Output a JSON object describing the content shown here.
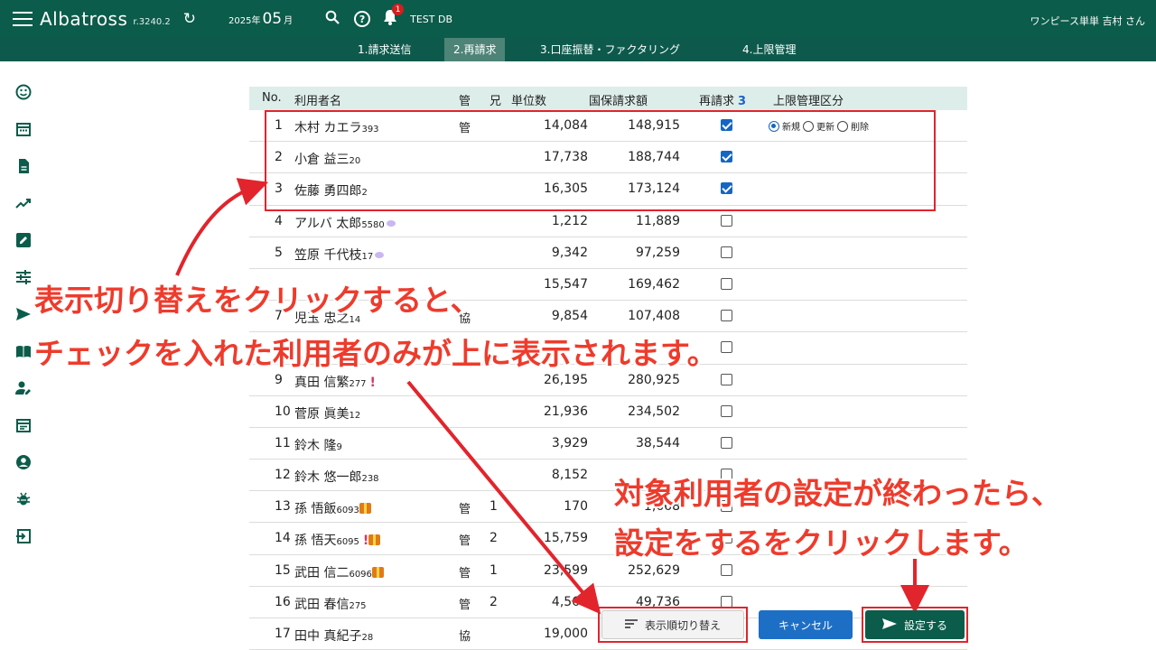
{
  "header": {
    "app_name": "Albatross",
    "version": "r.3240.2",
    "date_year": "2025年",
    "date_month": "05",
    "date_suffix": "月",
    "notification_count": "1",
    "db_name": "TEST DB",
    "user": "ワンピース単単 吉村 さん",
    "bg_color": "#0b5c4a"
  },
  "tabs": [
    {
      "label": "1.請求送信",
      "active": false
    },
    {
      "label": "2.再請求",
      "active": true
    },
    {
      "label": "3.口座振替・ファクタリング",
      "active": false
    },
    {
      "label": "4.上限管理",
      "active": false
    }
  ],
  "sidebar_icons": [
    "smiley-icon",
    "calendar-icon",
    "document-icon",
    "trend-icon",
    "edit-icon",
    "tune-icon",
    "send-icon",
    "book-icon",
    "user-edit-icon",
    "event-icon",
    "account-icon",
    "bug-icon",
    "login-icon"
  ],
  "table": {
    "headers": {
      "no": "No.",
      "name": "利用者名",
      "kan": "管",
      "ani": "兄",
      "unit": "単位数",
      "amount": "国保請求額",
      "resubmit": "再請求",
      "resubmit_count": "3",
      "limit": "上限管理区分"
    },
    "radio_labels": [
      "新規",
      "更新",
      "削除"
    ],
    "rows": [
      {
        "no": "1",
        "name": "木村 カエラ",
        "id": "393",
        "kan": "管",
        "ani": "",
        "unit": "14,084",
        "amount": "148,915",
        "checked": true
      },
      {
        "no": "2",
        "name": "小倉 益三",
        "id": "20",
        "kan": "",
        "ani": "",
        "unit": "17,738",
        "amount": "188,744",
        "checked": true
      },
      {
        "no": "3",
        "name": "佐藤 勇四郎",
        "id": "2",
        "kan": "",
        "ani": "",
        "unit": "16,305",
        "amount": "173,124",
        "checked": true
      },
      {
        "no": "4",
        "name": "アルバ 太郎",
        "id": "5580",
        "kan": "",
        "ani": "",
        "unit": "1,212",
        "amount": "11,889",
        "checked": false
      },
      {
        "no": "5",
        "name": "笠原 千代枝",
        "id": "17",
        "kan": "",
        "ani": "",
        "unit": "9,342",
        "amount": "97,259",
        "checked": false
      },
      {
        "no": "",
        "name": "",
        "id": "",
        "kan": "",
        "ani": "",
        "unit": "15,547",
        "amount": "169,462",
        "checked": false
      },
      {
        "no": "7",
        "name": "児玉 忠之",
        "id": "14",
        "kan": "協",
        "ani": "",
        "unit": "9,854",
        "amount": "107,408",
        "checked": false
      },
      {
        "no": "",
        "name": "",
        "id": "",
        "kan": "",
        "ani": "",
        "unit": "",
        "amount": "",
        "checked": false
      },
      {
        "no": "9",
        "name": "真田 信繁",
        "id": "277",
        "kan": "",
        "ani": "",
        "unit": "26,195",
        "amount": "280,925",
        "checked": false
      },
      {
        "no": "10",
        "name": "菅原 眞美",
        "id": "12",
        "kan": "",
        "ani": "",
        "unit": "21,936",
        "amount": "234,502",
        "checked": false
      },
      {
        "no": "11",
        "name": "鈴木 隆",
        "id": "9",
        "kan": "",
        "ani": "",
        "unit": "3,929",
        "amount": "38,544",
        "checked": false
      },
      {
        "no": "12",
        "name": "鈴木 悠一郎",
        "id": "238",
        "kan": "",
        "ani": "",
        "unit": "8,152",
        "amount": "",
        "checked": false
      },
      {
        "no": "13",
        "name": "孫 悟飯",
        "id": "6093",
        "kan": "管",
        "ani": "1",
        "unit": "170",
        "amount": "1,668",
        "checked": false
      },
      {
        "no": "14",
        "name": "孫 悟天",
        "id": "6095",
        "kan": "管",
        "ani": "2",
        "unit": "15,759",
        "amount": "",
        "checked": false
      },
      {
        "no": "15",
        "name": "武田 信二",
        "id": "6096",
        "kan": "管",
        "ani": "1",
        "unit": "23,599",
        "amount": "252,629",
        "checked": false
      },
      {
        "no": "16",
        "name": "武田 春信",
        "id": "275",
        "kan": "管",
        "ani": "2",
        "unit": "4,563",
        "amount": "49,736",
        "checked": false
      },
      {
        "no": "17",
        "name": "田中 真紀子",
        "id": "28",
        "kan": "協",
        "ani": "",
        "unit": "19,000",
        "amount": "",
        "checked": false
      }
    ]
  },
  "buttons": {
    "toggle": "表示順切り替え",
    "cancel": "キャンセル",
    "set": "設定する"
  },
  "annotations": {
    "line1": "表示切り替えをクリックすると、",
    "line2": "チェックを入れた利用者のみが上に表示されます。",
    "line3": "対象利用者の設定が終わったら、",
    "line4": "設定をするをクリックします。",
    "color": "#ee3b2c"
  }
}
